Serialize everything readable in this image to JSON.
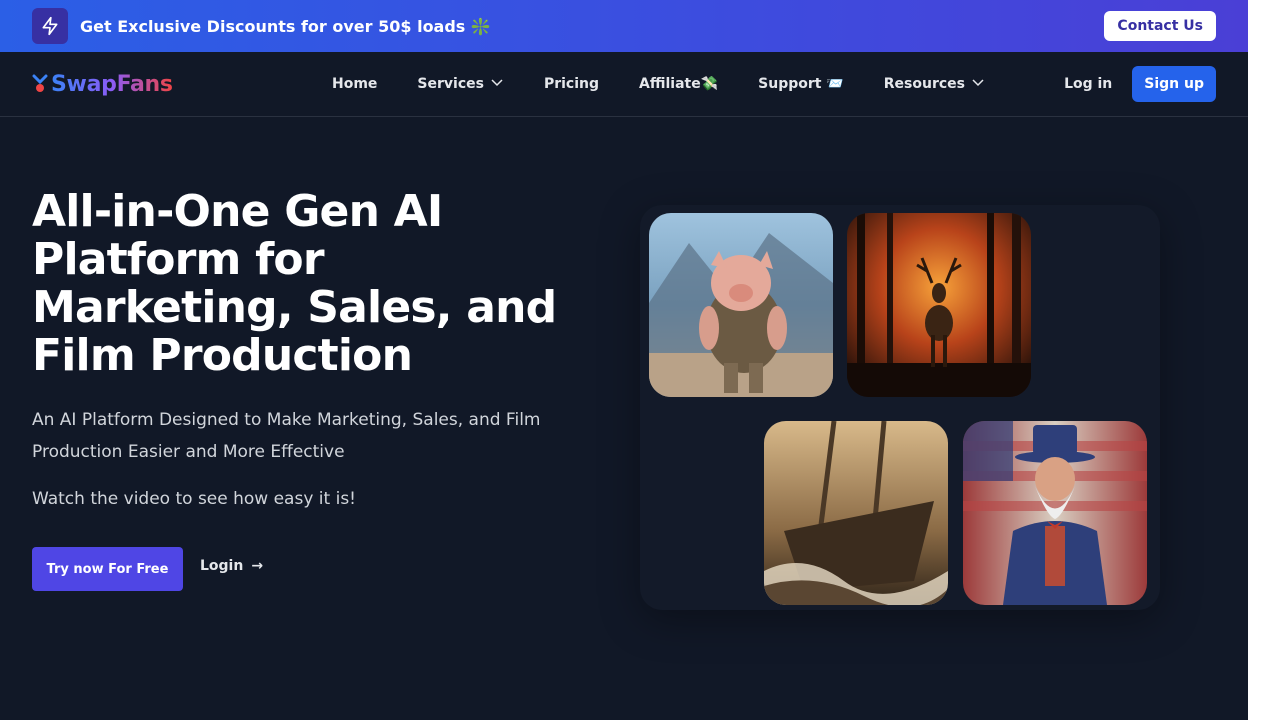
{
  "banner": {
    "text": "Get Exclusive Discounts for over 50$ loads ❇️",
    "contact_label": "Contact Us",
    "icon": "lightning-bolt-icon"
  },
  "nav": {
    "logo_text": "SwapFans",
    "items": [
      {
        "label": "Home"
      },
      {
        "label": "Services"
      },
      {
        "label": "Pricing"
      },
      {
        "label": "Affiliate💸"
      },
      {
        "label": "Support 📨"
      },
      {
        "label": "Resources"
      }
    ],
    "login_label": "Log in",
    "signup_label": "Sign up"
  },
  "hero": {
    "title": "All-in-One Gen AI Platform for Marketing, Sales, and Film Production",
    "subtitle": "An AI Platform Designed to Make Marketing, Sales, and Film Production Easier and More Effective",
    "watch_text": "Watch the video to see how easy it is!",
    "try_label": "Try now For Free",
    "login_label": "Login",
    "arrow": "→"
  },
  "gallery": [
    {
      "subject": "pig-warrior-image"
    },
    {
      "subject": "burning-forest-deer-image"
    },
    {
      "subject": "sinking-ship-image"
    },
    {
      "subject": "uncle-sam-image"
    }
  ],
  "colors": {
    "background": "#111827",
    "banner_gradient_start": "#2b5fe6",
    "banner_gradient_end": "#4a3fd6",
    "primary_button": "#4f46e5",
    "signup_button": "#2563eb"
  }
}
